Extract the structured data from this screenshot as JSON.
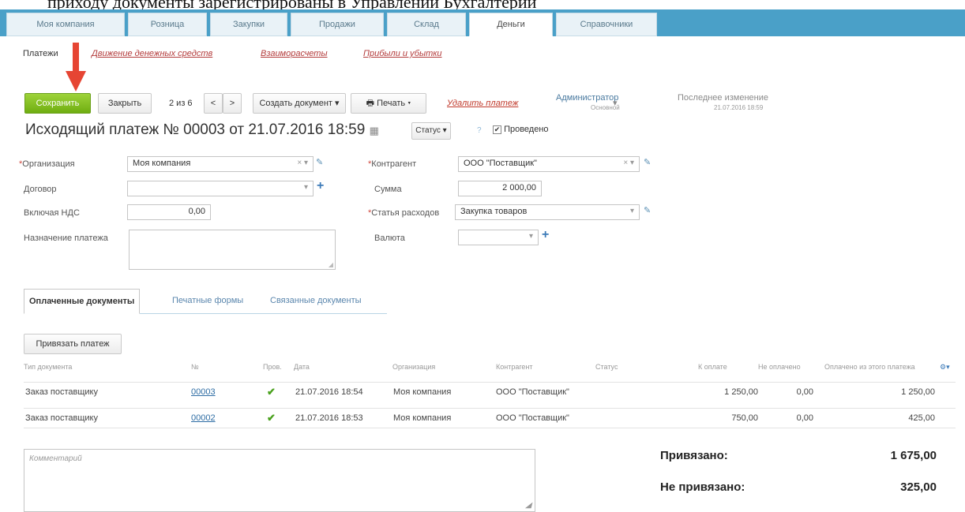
{
  "caption": "приходу документы зарегистрированы в Управлении Бухгалтерии",
  "nav": {
    "tabs": [
      "Моя компания",
      "Розница",
      "Закупки",
      "Продажи",
      "Склад",
      "Деньги",
      "Справочники"
    ],
    "active": "Деньги"
  },
  "subnav": {
    "current": "Платежи",
    "links": [
      "Движение денежных средств",
      "Взаиморасчеты",
      "Прибыли и убытки"
    ]
  },
  "toolbar": {
    "save": "Сохранить",
    "close": "Закрыть",
    "pager": "2 из 6",
    "prev": "<",
    "next": ">",
    "create": "Создать документ",
    "print": "Печать",
    "delete": "Удалить платеж",
    "user": "Администратор",
    "user_sub": "Основной",
    "last_change_label": "Последнее изменение",
    "last_change_value": "21.07.2016 18:59"
  },
  "header": {
    "title": "Исходящий платеж №  00003  от  21.07.2016 18:59",
    "status": "Статус",
    "help": "?",
    "posted": "Проведено"
  },
  "form": {
    "org_label": "Организация",
    "org_value": "Моя компания",
    "contract_label": "Договор",
    "contract_value": "",
    "vat_label": "Включая НДС",
    "vat_value": "0,00",
    "purpose_label": "Назначение платежа",
    "counterparty_label": "Контрагент",
    "counterparty_value": "ООО \"Поставщик\"",
    "sum_label": "Сумма",
    "sum_value": "2 000,00",
    "expense_label": "Статья расходов",
    "expense_value": "Закупка товаров",
    "currency_label": "Валюта",
    "currency_value": ""
  },
  "subtabs": [
    "Оплаченные документы",
    "Печатные формы",
    "Связанные документы"
  ],
  "bind_button": "Привязать платеж",
  "table": {
    "columns": [
      "Тип документа",
      "№",
      "Пров.",
      "Дата",
      "Организация",
      "Контрагент",
      "Статус",
      "К оплате",
      "Не оплачено",
      "Оплачено из этого платежа"
    ],
    "rows": [
      {
        "type": "Заказ поставщику",
        "num": "00003",
        "date": "21.07.2016 18:54",
        "org": "Моя компания",
        "counterparty": "ООО \"Поставщик\"",
        "status": "",
        "to_pay": "1 250,00",
        "unpaid": "0,00",
        "paid": "1 250,00"
      },
      {
        "type": "Заказ поставщику",
        "num": "00002",
        "date": "21.07.2016 18:53",
        "org": "Моя компания",
        "counterparty": "ООО \"Поставщик\"",
        "status": "",
        "to_pay": "750,00",
        "unpaid": "0,00",
        "paid": "425,00"
      }
    ]
  },
  "comment_placeholder": "Комментарий",
  "totals": {
    "bound_label": "Привязано:",
    "bound_value": "1 675,00",
    "unbound_label": "Не привязано:",
    "unbound_value": "325,00"
  },
  "colors": {
    "nav": "#4aa0c8",
    "save": "#7dbb1f",
    "arrow": "#e64533",
    "check": "#4aa11d"
  }
}
